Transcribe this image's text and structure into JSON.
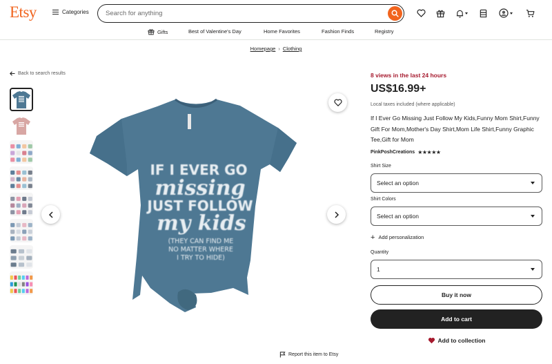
{
  "header": {
    "logo": "Etsy",
    "categories_label": "Categories",
    "search_placeholder": "Search for anything"
  },
  "icons": {
    "search": "search-icon",
    "favorites": "heart-icon",
    "gift": "gift-icon",
    "notifications": "bell-icon",
    "shop": "shop-icon",
    "account": "avatar-icon",
    "cart": "cart-icon"
  },
  "nav": {
    "items": [
      "Gifts",
      "Best of Valentine's Day",
      "Home Favorites",
      "Fashion Finds",
      "Registry"
    ]
  },
  "breadcrumb": {
    "items": [
      "Homepage",
      "Clothing"
    ]
  },
  "back_link": "Back to search results",
  "product_image": {
    "shirt_color": "#4e7893",
    "shirt_text": [
      "IF I EVER GO",
      "missing",
      "JUST FOLLOW",
      "my kids",
      "(THEY CAN FIND ME",
      "NO MATTER WHERE",
      "I TRY TO HIDE)"
    ]
  },
  "thumbnails": {
    "colors": [
      "#4e7893",
      "#d8a7a4",
      "#e7e0e4",
      "#cfd3da",
      "#b9bdc9",
      "#dcdfe3",
      "#e6e6e6",
      "#f1ede7"
    ]
  },
  "product": {
    "views": "8 views in the last 24 hours",
    "price": "US$16.99+",
    "tax_note": "Local taxes included (where applicable)",
    "title": "If I Ever Go Missing Just Follow My Kids,Funny Mom Shirt,Funny Gift For Mom,Mother's Day Shirt,Mom Life Shirt,Funny Graphic Tee,Gift for Mom",
    "shop_name": "PinkPoshCreations",
    "stars": "★★★★★",
    "shirt_size_label": "Shirt Size",
    "shirt_size_value": "Select an option",
    "shirt_colors_label": "Shirt Colors",
    "shirt_colors_value": "Select an option",
    "add_personalization": "Add personalization",
    "quantity_label": "Quantity",
    "quantity_value": "1",
    "buy_now": "Buy it now",
    "add_to_cart": "Add to cart",
    "add_to_collection": "Add to collection",
    "report": "Report this item to Etsy"
  },
  "colors": {
    "brand": "#f1641e",
    "views": "#a61a2e",
    "collection_heart": "#a61a2e"
  }
}
